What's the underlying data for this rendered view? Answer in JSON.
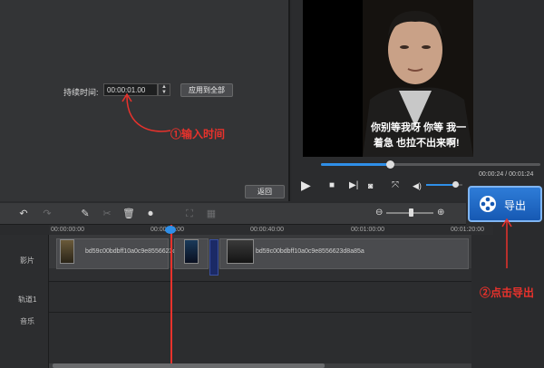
{
  "settings": {
    "duration_label": "持续时间:",
    "duration_value": "00:00:01.00",
    "apply_all_label": "应用到全部",
    "back_label": "返回"
  },
  "preview": {
    "subtitle_line1": "你别等我呀 你等 我一",
    "subtitle_line2": "着急 也拉不出来啊!",
    "time_display": "00:00:24 / 00:01:24",
    "seek_progress": 0.31,
    "volume_level": 0.8
  },
  "export": {
    "label": "导出"
  },
  "timeline": {
    "ruler_ticks": [
      "00:00:00:00",
      "00:00:20:00",
      "00:00:40:00",
      "00:01:00:00",
      "00:01:20:00"
    ],
    "tracks": [
      "影片",
      "轨道1",
      "音乐"
    ],
    "clips": [
      {
        "name": "bd59c00bdbff10a0c9e8556623d8a85a"
      },
      {
        "name": "bd59c00bdbff10a0c9e8556623d8a85a"
      }
    ],
    "zoom_level": 0.5
  },
  "annotations": {
    "step1": "①输入时间",
    "step2": "②点击导出"
  },
  "icons": {
    "play": "play-icon",
    "stop": "stop-icon",
    "next_frame": "next-frame-icon",
    "snapshot": "camera-icon",
    "fullscreen": "fullscreen-icon",
    "volume": "volume-icon",
    "undo": "undo-icon",
    "redo": "redo-icon",
    "edit": "edit-icon",
    "cut": "scissors-icon",
    "delete": "trash-icon",
    "record": "microphone-icon",
    "crop": "crop-icon",
    "mosaic": "mosaic-icon",
    "export": "film-reel-icon"
  },
  "colors": {
    "accent": "#2f8fe8",
    "annotation": "#e8322c"
  }
}
